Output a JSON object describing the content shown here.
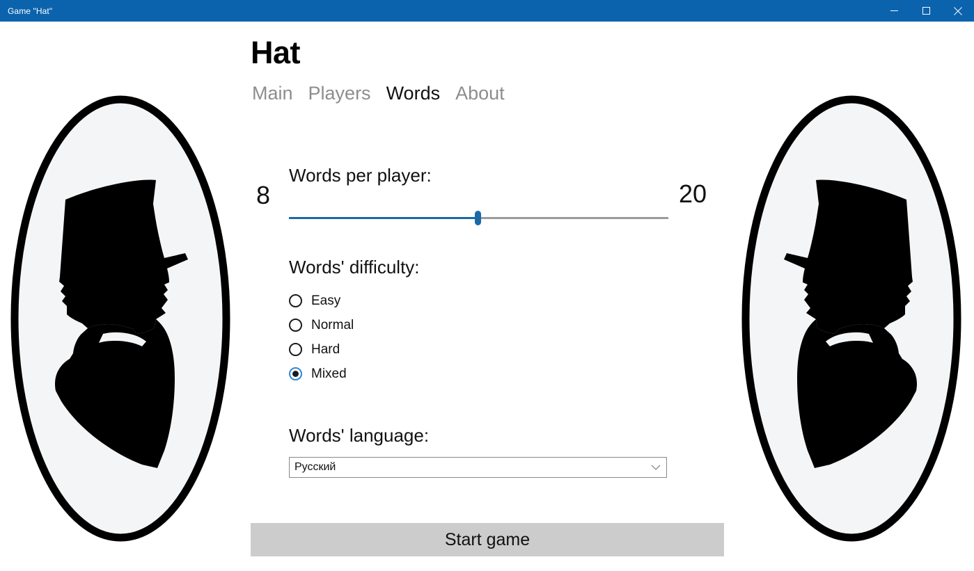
{
  "window": {
    "title": "Game \"Hat\"",
    "accent_color": "#0b63ad",
    "controls": {
      "minimize": "Minimize",
      "maximize": "Maximize",
      "close": "Close"
    }
  },
  "app": {
    "title": "Hat"
  },
  "tabs": [
    {
      "label": "Main",
      "active": false
    },
    {
      "label": "Players",
      "active": false
    },
    {
      "label": "Words",
      "active": true
    },
    {
      "label": "About",
      "active": false
    }
  ],
  "words_per_player": {
    "label": "Words per player:",
    "min": "8",
    "max": "20",
    "value": "14",
    "fill_percent": "49.7",
    "track_color": "#9b9b9b",
    "fill_color": "#1a6aa8"
  },
  "difficulty": {
    "heading": "Words' difficulty:",
    "selected": "Mixed",
    "options": [
      {
        "label": "Easy",
        "selected": false
      },
      {
        "label": "Normal",
        "selected": false
      },
      {
        "label": "Hard",
        "selected": false
      },
      {
        "label": "Mixed",
        "selected": true
      }
    ]
  },
  "language": {
    "heading": "Words' language:",
    "value": "Русский"
  },
  "start": {
    "label": "Start game",
    "background": "#cccccc"
  },
  "decoration": {
    "name": "silhouette-cameo",
    "description": "Oval cameo with two facing top-hat gentlemen silhouettes"
  }
}
